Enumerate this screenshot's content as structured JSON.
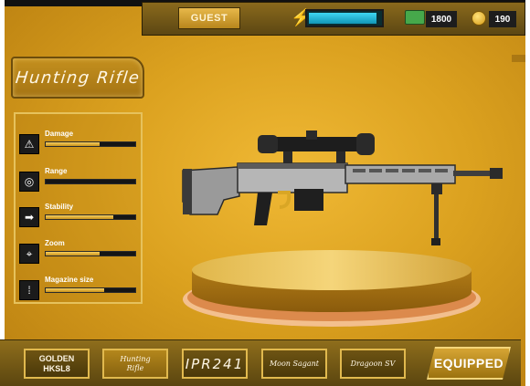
{
  "header": {
    "player_name": "GUEST",
    "energy_level": 0.95,
    "cash": "1800",
    "coins": "190"
  },
  "weapon": {
    "title": "Hunting Rifle"
  },
  "stats": [
    {
      "label": "Damage",
      "icon": "warning-triangle-icon",
      "level": 0.6
    },
    {
      "label": "Range",
      "icon": "target-icon",
      "level": 0.0
    },
    {
      "label": "Stability",
      "icon": "arrow-right-icon",
      "level": 0.75
    },
    {
      "label": "Zoom",
      "icon": "crosshair-icon",
      "level": 0.6
    },
    {
      "label": "Magazine size",
      "icon": "ammo-icon",
      "level": 0.65
    }
  ],
  "weapon_tabs": [
    {
      "label": "GOLDEN\nHKSL8"
    },
    {
      "label": "Hunting\nRifle"
    },
    {
      "label": "IPR241"
    },
    {
      "label": "Moon Sagant"
    },
    {
      "label": "Dragoon SV"
    }
  ],
  "equipped_label": "EQUIPPED",
  "colors": {
    "gold_accent": "#e1b94e",
    "energy": "#27d3f0",
    "background": "#dba11f"
  }
}
